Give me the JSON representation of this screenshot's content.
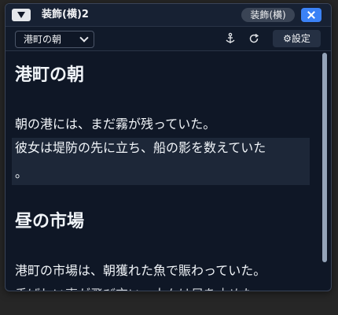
{
  "window": {
    "title": "装飾(横)2",
    "mode_badge": "装飾(横)",
    "icons": {
      "collapse": "triangle-down-icon",
      "close": "close-icon"
    }
  },
  "toolbar": {
    "selected_document": "港町の朝",
    "settings_label": "⚙設定",
    "icons": {
      "anchor": "anchor-icon",
      "refresh": "refresh-icon"
    }
  },
  "content": {
    "heading_1": "港町の朝",
    "para_1": "朝の港には、まだ霧が残っていた。",
    "para_2_line_1": "彼女は堤防の先に立ち、船の影を数えていた",
    "para_2_line_2": "。",
    "ruby_marks": "、、",
    "heading_2": "昼の市場",
    "para_3": "港町の市場は、朝獲れた魚で賑わっていた。",
    "para_4_partial": "香ばしい声が飛び交い、人々は足を止めた。"
  },
  "colors": {
    "window_bg": "#0f1726",
    "titlebar_bg": "#172133",
    "accent_blue": "#3b82f6",
    "highlight_bg": "#1d2738",
    "text": "#f1f5f9"
  }
}
